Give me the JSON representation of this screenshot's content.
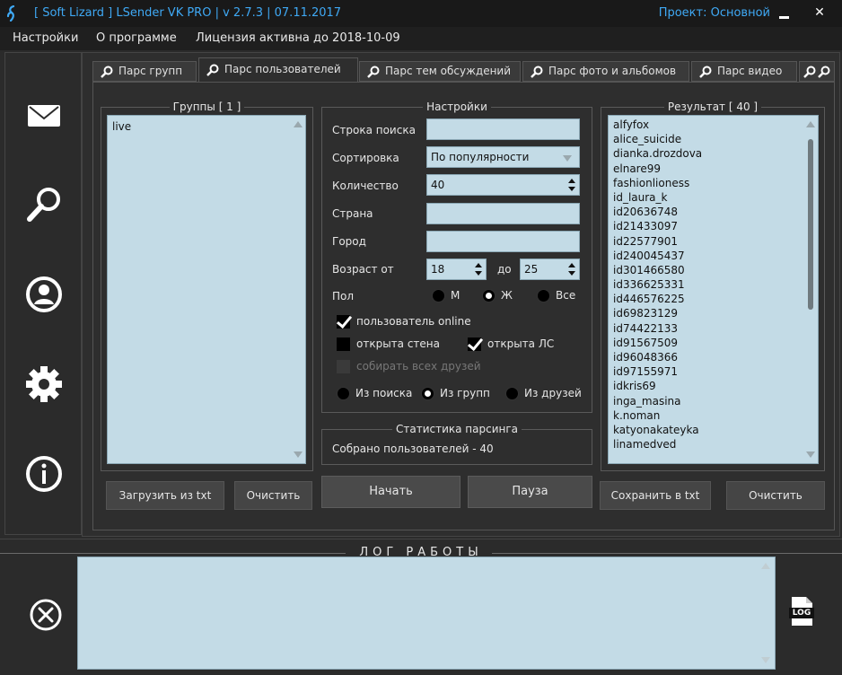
{
  "window": {
    "title": "[ Soft Lizard ] LSender VK PRO | v 2.7.3 | 07.11.2017",
    "project": "Проект: Основной",
    "close_glyph": "✕"
  },
  "menu": {
    "settings": "Настройки",
    "about": "О программе",
    "license": "Лицензия активна до 2018-10-09"
  },
  "sidebar": {
    "icons": [
      "envelope-icon",
      "search-icon",
      "user-icon",
      "gear-icon",
      "info-icon"
    ]
  },
  "tabs": [
    {
      "label": "Парс групп",
      "active": false
    },
    {
      "label": "Парс пользователей",
      "active": true
    },
    {
      "label": "Парс тем обсуждений",
      "active": false
    },
    {
      "label": "Парс фото и альбомов",
      "active": false
    },
    {
      "label": "Парс видео",
      "active": false
    }
  ],
  "groups": {
    "title": "Группы [ 1 ]",
    "items": [
      "live"
    ],
    "load_button": "Загрузить из txt",
    "clear_button": "Очистить"
  },
  "settings": {
    "title": "Настройки",
    "search_label": "Строка поиска",
    "search_value": "",
    "sort_label": "Сортировка",
    "sort_value": "По популярности",
    "count_label": "Количество",
    "count_value": "40",
    "country_label": "Страна",
    "country_value": "",
    "city_label": "Город",
    "city_value": "",
    "age_from_label": "Возраст от",
    "age_from_value": "18",
    "age_to_label": "до",
    "age_to_value": "25",
    "gender_label": "Пол",
    "gender_options": [
      "М",
      "Ж",
      "Все"
    ],
    "gender_selected": "Ж",
    "online_label": "пользователь online",
    "online_checked": true,
    "wall_open_label": "открыта стена",
    "wall_open_checked": false,
    "pm_open_label": "открыта ЛС",
    "pm_open_checked": true,
    "collect_friends_label": "собирать всех друзей",
    "collect_friends_checked": false,
    "source_options": [
      "Из поиска",
      "Из групп",
      "Из друзей"
    ],
    "source_selected": "Из групп"
  },
  "stats": {
    "title": "Статистика парсинга",
    "collected": "Собрано пользователей - 40"
  },
  "actions": {
    "start": "Начать",
    "pause": "Пауза"
  },
  "result": {
    "title": "Результат [ 40 ]",
    "items": [
      "alfyfox",
      "alice_suicide",
      "dianka.drozdova",
      "elnare99",
      "fashionlioness",
      "id_laura_k",
      "id20636748",
      "id21433097",
      "id22577901",
      "id240045437",
      "id301466580",
      "id336625331",
      "id446576225",
      "id69823129",
      "id74422133",
      "id91567509",
      "id96048366",
      "id97155971",
      "idkris69",
      "inga_masina",
      "k.noman",
      "katyonakateyka",
      "linamedved"
    ],
    "save_button": "Сохранить в txt",
    "clear_button": "Очистить"
  },
  "log": {
    "title": "ЛОГ РАБОТЫ",
    "log_icon_text": "LOG"
  },
  "colors": {
    "accent": "#3fa9f5",
    "field_bg": "#c3dbe6",
    "panel_bg": "#2e2e2e"
  }
}
